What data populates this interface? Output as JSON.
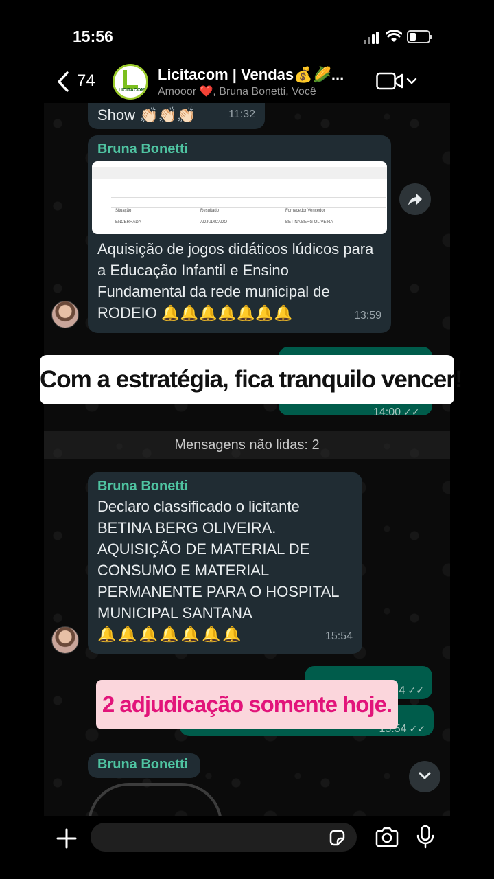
{
  "status_bar": {
    "time": "15:56"
  },
  "header": {
    "back_count": "74",
    "avatar_text": "LICITACOM",
    "title": "Licitacom  | Vendas💰🌽...",
    "subtitle": "Amooor ❤️, Bruna Bonetti, Você"
  },
  "messages": [
    {
      "text": "Show 👏🏻👏🏻👏🏻",
      "time": "11:32"
    },
    {
      "sender": "Bruna Bonetti",
      "doc_table": {
        "headers": [
          "Situação",
          "Resultado",
          "Fornecedor Vencedor"
        ],
        "row": [
          "ENCERRADA",
          "ADJUDICADO",
          "BETINA BERG OLIVEIRA"
        ]
      },
      "text": "Aquisição de jogos didáticos lúdicos para a Educação Infantil e Ensino Fundamental da rede municipal de RODEIO 🔔🔔🔔🔔🔔🔔🔔",
      "time": "13:59"
    },
    {
      "time": "14:00"
    },
    {
      "sender": "Bruna Bonetti",
      "lines": [
        "Declaro classificado o licitante",
        "BETINA BERG OLIVEIRA.",
        "AQUISIÇÃO DE MATERIAL DE",
        "CONSUMO E MATERIAL",
        "PERMANENTE PARA O HOSPITAL",
        "MUNICIPAL SANTANA"
      ],
      "bells": "🔔🔔🔔🔔🔔🔔🔔",
      "time": "15:54"
    },
    {
      "time": "4"
    },
    {
      "time": "15:54"
    },
    {
      "sender": "Bruna Bonetti"
    }
  ],
  "unread_divider": "Mensagens não lidas: 2",
  "captions": {
    "top": "Com a estratégia, fica tranquilo vencer!",
    "bottom": "2 adjudicação somente hoje."
  },
  "input": {
    "placeholder": ""
  },
  "colors": {
    "incoming_bubble": "#202c33",
    "outgoing_bubble": "#005c4b",
    "sender_name": "#4fc3a1",
    "caption_pink_text": "#e2147a",
    "caption_pink_bg": "#fbd6dc"
  },
  "icons": [
    "back-chevron-icon",
    "video-camera-icon",
    "forward-icon",
    "chevron-down-icon",
    "plus-icon",
    "sticker-icon",
    "camera-icon",
    "microphone-icon",
    "read-ticks-icon"
  ]
}
